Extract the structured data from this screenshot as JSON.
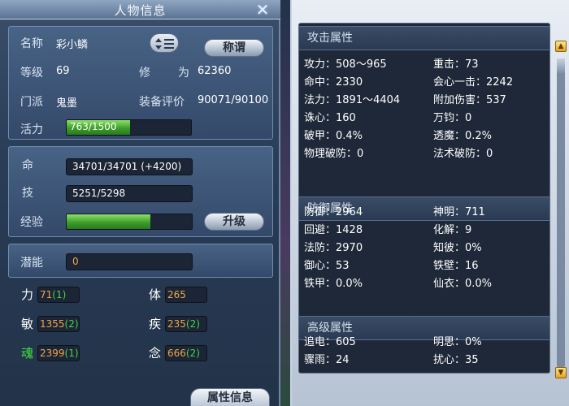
{
  "window": {
    "title": "人物信息"
  },
  "profile": {
    "name_label": "名称",
    "name_value": "彩小鳞",
    "title_button": "称谓",
    "level_label": "等级",
    "level_value": "69",
    "cultivation_label": "修",
    "cultivation_label2": "为",
    "cultivation_value": "62360",
    "sect_label": "门派",
    "sect_value": "鬼墨",
    "equip_label": "装备评价",
    "equip_value": "90071/90100",
    "vitality_label": "活力",
    "vitality_value": "763/1500",
    "vitality_fraction": 0.51
  },
  "vitals": {
    "hp_label": "命",
    "hp_value": "34701/34701 (+4200)",
    "skill_label": "技",
    "skill_value": "5251/5298",
    "exp_label": "经验",
    "exp_fraction": 0.67,
    "upgrade_button": "升级"
  },
  "potential": {
    "label": "潜能",
    "value": "0"
  },
  "attributes": [
    {
      "label": "力",
      "value": "71",
      "bonus": "(1)",
      "color": "#ffffff"
    },
    {
      "label": "体",
      "value": "265",
      "bonus": "",
      "color": "#ffffff"
    },
    {
      "label": "敏",
      "value": "1355",
      "bonus": "(2)",
      "color": "#ffffff"
    },
    {
      "label": "疾",
      "value": "235",
      "bonus": "(2)",
      "color": "#ffffff"
    },
    {
      "label": "魂",
      "value": "2399",
      "bonus": "(1)",
      "color": "#3ee83e"
    },
    {
      "label": "念",
      "value": "666",
      "bonus": "(2)",
      "color": "#ffffff"
    }
  ],
  "tab_button": "属性信息",
  "attack_section": {
    "title": "攻击属性",
    "stats": [
      [
        "攻力：508～965",
        "重击：73"
      ],
      [
        "命中：2330",
        "会心一击：2242"
      ],
      [
        "法力：1891～4404",
        "附加伤害：537"
      ],
      [
        "诛心：160",
        "万钧：0"
      ],
      [
        "破甲：0.4%",
        "透魔：0.2%"
      ],
      [
        "物理破防：0",
        "法术破防：0"
      ]
    ]
  },
  "defense_section": {
    "title": "防御属性",
    "stats": [
      [
        "防御：2964",
        "神明：711"
      ],
      [
        "回避：1428",
        "化解：9"
      ],
      [
        "法防：2970",
        "知彼：0%"
      ],
      [
        "御心：53",
        "铁壁：16"
      ],
      [
        "铁甲：0.0%",
        "仙衣：0.0%"
      ]
    ]
  },
  "advanced_section": {
    "title": "高级属性",
    "stats": [
      [
        "追电：605",
        "明思：0%"
      ],
      [
        "骤雨：24",
        "扰心：35"
      ]
    ]
  },
  "colors": {
    "accent_green": "#3c9e2a",
    "attr_orange": "#f0a64a",
    "bonus_green": "#48d24a"
  }
}
